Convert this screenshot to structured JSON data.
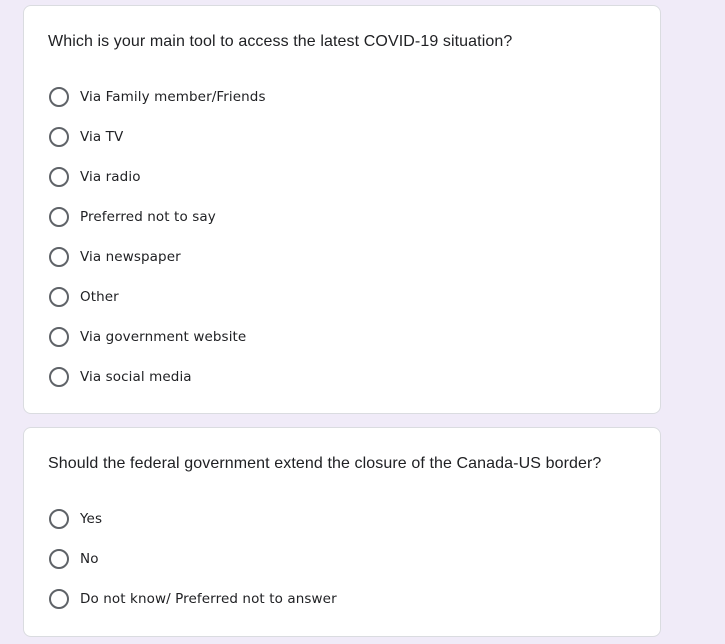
{
  "questions": [
    {
      "title": "Which is your main tool to access the latest COVID-19 situation?",
      "options": [
        "Via Family member/Friends",
        "Via TV",
        "Via radio",
        "Preferred not to say",
        "Via newspaper",
        "Other",
        "Via government website",
        "Via social media"
      ]
    },
    {
      "title": "Should the federal government extend the closure of the Canada-US border?",
      "options": [
        "Yes",
        "No",
        "Do not know/ Preferred not to answer"
      ]
    }
  ],
  "colors": {
    "page_background": "#f0ebf8",
    "card_background": "#ffffff",
    "card_border": "#dadce0",
    "radio_border": "#5f6368",
    "text": "#202124"
  },
  "icons": {
    "radio": "radio-unchecked-icon"
  }
}
